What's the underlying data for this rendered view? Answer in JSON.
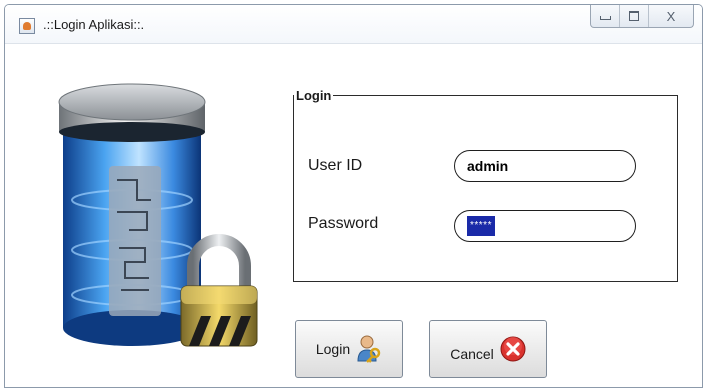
{
  "window": {
    "title": ".::Login Aplikasi::.",
    "controls": {
      "minimize": "minimize",
      "maximize": "maximize",
      "close": "X"
    }
  },
  "graphic": {
    "icon": "database-lock-icon"
  },
  "form": {
    "group_title": "Login",
    "user_label": "User ID",
    "user_value": "admin",
    "password_label": "Password",
    "password_value": "*****"
  },
  "buttons": {
    "login_label": "Login",
    "login_icon": "user-key-icon",
    "cancel_label": "Cancel",
    "cancel_icon": "cancel-x-icon"
  },
  "colors": {
    "selection": "#1a2aa8",
    "cancel_red": "#d9322e",
    "cylinder_blue": "#3c8ee8"
  }
}
